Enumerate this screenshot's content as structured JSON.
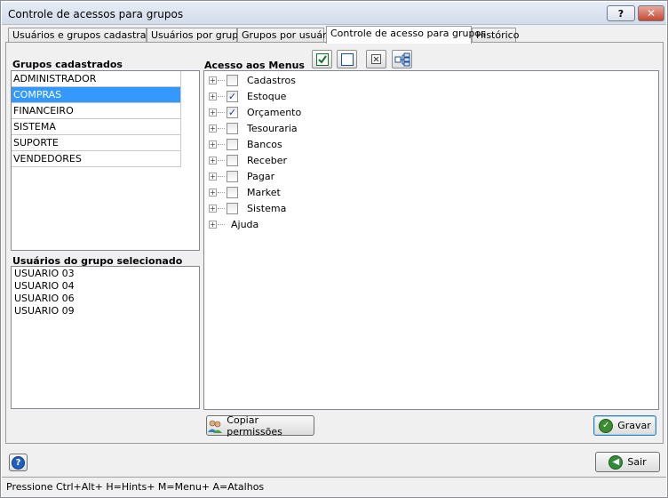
{
  "window": {
    "title": "Controle de acessos para grupos",
    "help_label": "?",
    "close_label": "✕"
  },
  "tabs": [
    {
      "label": "Usuários e grupos cadastrados"
    },
    {
      "label": "Usuários por grupo"
    },
    {
      "label": "Grupos por usuário"
    },
    {
      "label": "Controle de acesso para grupos",
      "active": true
    },
    {
      "label": "Histórico"
    }
  ],
  "groups": {
    "label": "Grupos cadastrados",
    "items": [
      "ADMINISTRADOR",
      "COMPRAS",
      "FINANCEIRO",
      "SISTEMA",
      "SUPORTE",
      "VENDEDORES"
    ],
    "selected": "COMPRAS"
  },
  "users": {
    "label": "Usuários do grupo selecionado",
    "items": [
      "USUARIO 03",
      "USUARIO 04",
      "USUARIO 06",
      "USUARIO 09"
    ]
  },
  "menus": {
    "label": "Acesso aos Menus",
    "toolbar": [
      "check-all-icon",
      "uncheck-all-icon",
      "collapse-all-icon",
      "expand-all-icon"
    ],
    "items": [
      {
        "label": "Cadastros",
        "checked": false,
        "has_checkbox": true
      },
      {
        "label": "Estoque",
        "checked": true,
        "has_checkbox": true
      },
      {
        "label": "Orçamento",
        "checked": true,
        "has_checkbox": true
      },
      {
        "label": "Tesouraria",
        "checked": false,
        "has_checkbox": true
      },
      {
        "label": "Bancos",
        "checked": false,
        "has_checkbox": true
      },
      {
        "label": "Receber",
        "checked": false,
        "has_checkbox": true
      },
      {
        "label": "Pagar",
        "checked": false,
        "has_checkbox": true
      },
      {
        "label": "Market",
        "checked": false,
        "has_checkbox": true
      },
      {
        "label": "Sistema",
        "checked": false,
        "has_checkbox": true
      },
      {
        "label": "Ajuda",
        "checked": false,
        "has_checkbox": false
      }
    ]
  },
  "buttons": {
    "copy": "Copiar permissões",
    "save": "Gravar",
    "exit": "Sair"
  },
  "status": {
    "text": "Pressione Ctrl+Alt+ H=Hints+ M=Menu+ A=Atalhos"
  },
  "colors": {
    "selection": "#3399ff",
    "checkmark": "#1c3f94",
    "save_icon": "#3c8d2f",
    "exit_icon": "#2f8d3a",
    "help_icon": "#1f5fbf"
  }
}
